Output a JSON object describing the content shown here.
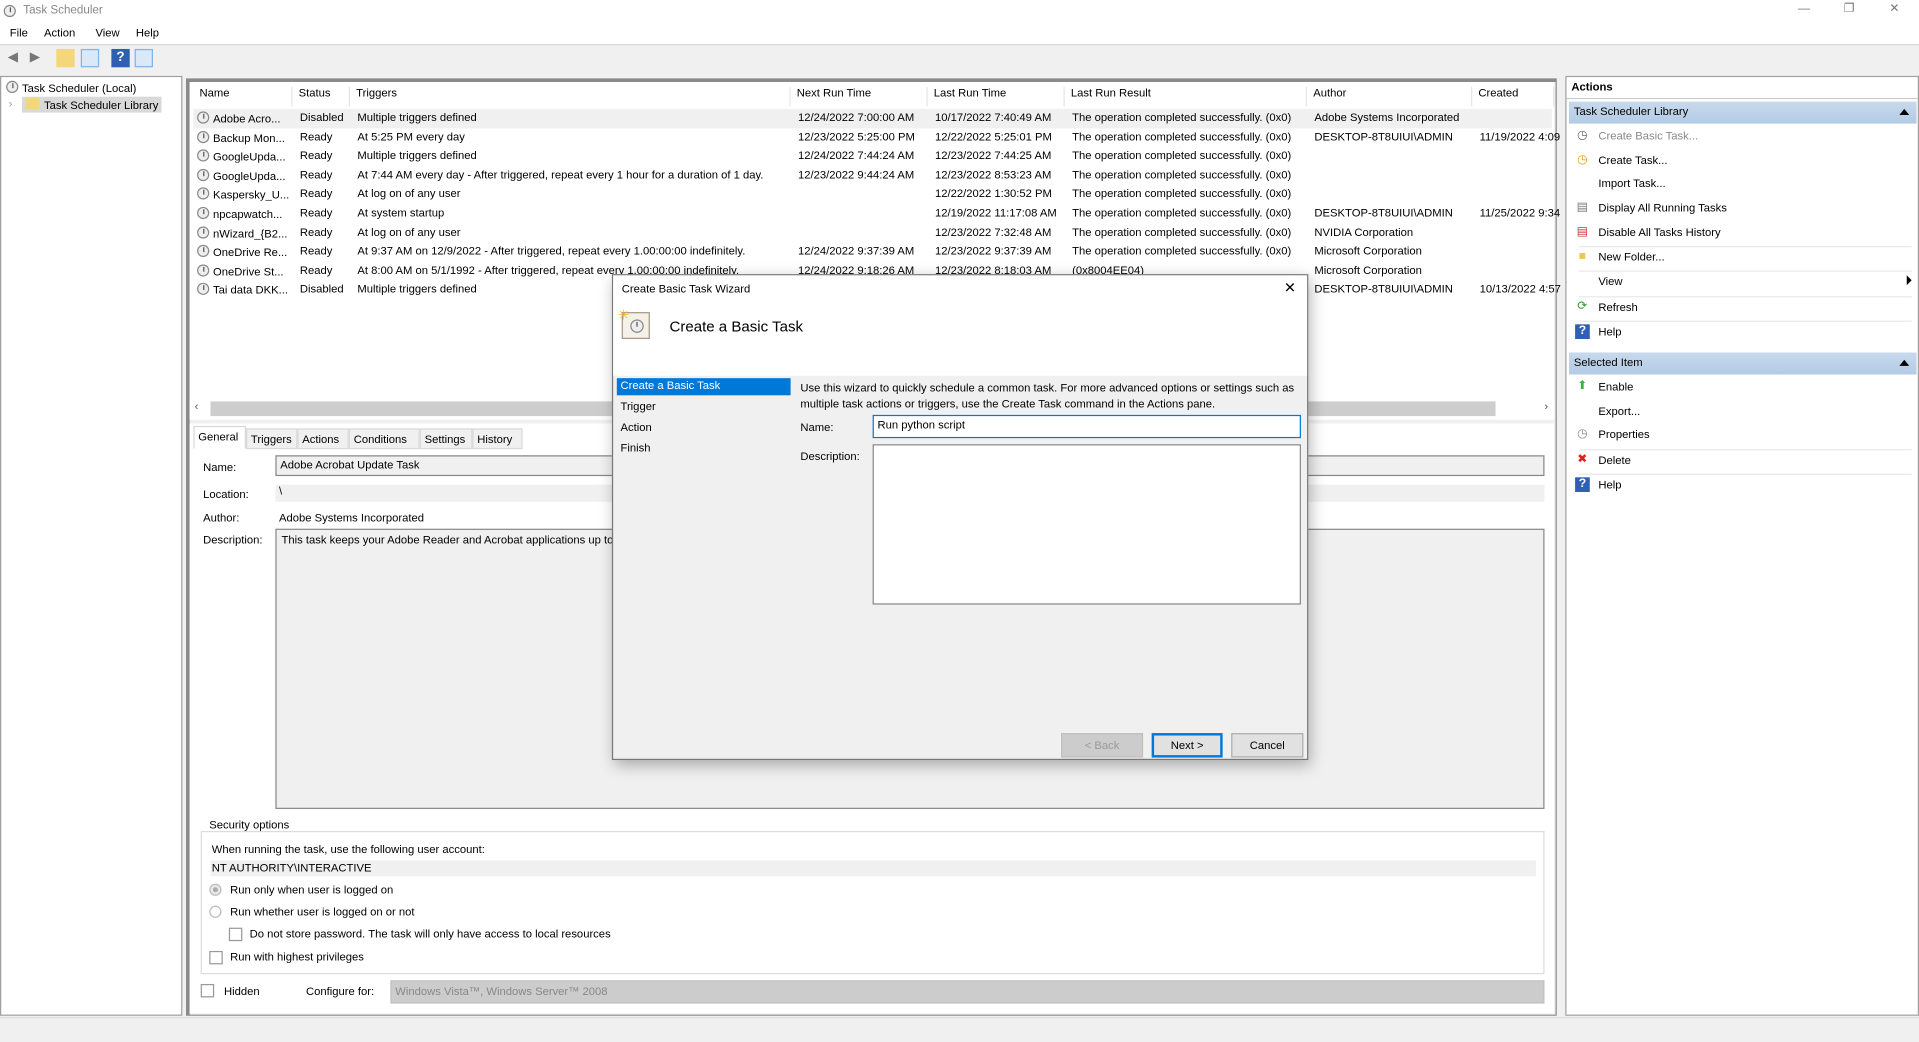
{
  "window": {
    "title": "Task Scheduler",
    "controls": [
      "minimize",
      "restore",
      "close"
    ]
  },
  "menu": [
    "File",
    "Action",
    "View",
    "Help"
  ],
  "toolbar": {
    "icons": [
      "back-icon",
      "forward-icon",
      "up-folder-icon",
      "show-hide-console-tree-icon",
      "help-icon",
      "show-hide-action-pane-icon"
    ]
  },
  "tree": {
    "root": "Task Scheduler (Local)",
    "child": "Task Scheduler Library"
  },
  "list": {
    "columns": [
      "Name",
      "Status",
      "Triggers",
      "Next Run Time",
      "Last Run Time",
      "Last Run Result",
      "Author",
      "Created"
    ],
    "rows": [
      [
        "Adobe Acro...",
        "Disabled",
        "Multiple triggers defined",
        "12/24/2022 7:00:00 AM",
        "10/17/2022 7:40:49 AM",
        "The operation completed successfully. (0x0)",
        "Adobe Systems Incorporated",
        ""
      ],
      [
        "Backup Mon...",
        "Ready",
        "At 5:25 PM every day",
        "12/23/2022 5:25:00 PM",
        "12/22/2022 5:25:01 PM",
        "The operation completed successfully. (0x0)",
        "DESKTOP-8T8UIUI\\ADMIN",
        "11/19/2022 4:09"
      ],
      [
        "GoogleUpda...",
        "Ready",
        "Multiple triggers defined",
        "12/24/2022 7:44:24 AM",
        "12/23/2022 7:44:25 AM",
        "The operation completed successfully. (0x0)",
        "",
        ""
      ],
      [
        "GoogleUpda...",
        "Ready",
        "At 7:44 AM every day - After triggered, repeat every 1 hour for a duration of 1 day.",
        "12/23/2022 9:44:24 AM",
        "12/23/2022 8:53:23 AM",
        "The operation completed successfully. (0x0)",
        "",
        ""
      ],
      [
        "Kaspersky_U...",
        "Ready",
        "At log on of any user",
        "",
        "12/22/2022 1:30:52 PM",
        "The operation completed successfully. (0x0)",
        "",
        ""
      ],
      [
        "npcapwatch...",
        "Ready",
        "At system startup",
        "",
        "12/19/2022 11:17:08 AM",
        "The operation completed successfully. (0x0)",
        "DESKTOP-8T8UIUI\\ADMIN",
        "11/25/2022 9:34"
      ],
      [
        "nWizard_{B2...",
        "Ready",
        "At log on of any user",
        "",
        "12/23/2022 7:32:48 AM",
        "The operation completed successfully. (0x0)",
        "NVIDIA Corporation",
        ""
      ],
      [
        "OneDrive Re...",
        "Ready",
        "At 9:37 AM on 12/9/2022 - After triggered, repeat every 1.00:00:00 indefinitely.",
        "12/24/2022 9:37:39 AM",
        "12/23/2022 9:37:39 AM",
        "The operation completed successfully. (0x0)",
        "Microsoft Corporation",
        ""
      ],
      [
        "OneDrive St...",
        "Ready",
        "At 8:00 AM on 5/1/1992 - After triggered, repeat every 1.00:00:00 indefinitely.",
        "12/24/2022 9:18:26 AM",
        "12/23/2022 8:18:03 AM",
        "(0x8004EE04)",
        "Microsoft Corporation",
        ""
      ],
      [
        "Tai data DKK...",
        "Disabled",
        "Multiple triggers defined",
        "",
        "",
        "",
        "DESKTOP-8T8UIUI\\ADMIN",
        "10/13/2022 4:57"
      ]
    ]
  },
  "detail": {
    "tabs": [
      "General",
      "Triggers",
      "Actions",
      "Conditions",
      "Settings",
      "History"
    ],
    "name_label": "Name:",
    "name_value": "Adobe Acrobat Update Task",
    "location_label": "Location:",
    "location_value": "\\",
    "author_label": "Author:",
    "author_value": "Adobe Systems Incorporated",
    "description_label": "Description:",
    "description_value": "This task keeps your Adobe Reader and Acrobat applications up to date with the latest enhancements and security fixes",
    "security": {
      "legend": "Security options",
      "account_label": "When running the task, use the following user account:",
      "account_value": "NT AUTHORITY\\INTERACTIVE",
      "radio1": "Run only when user is logged on",
      "radio2": "Run whether user is logged on or not",
      "no_store": "Do not store password.  The task will only have access to local resources",
      "highest": "Run with highest privileges"
    },
    "hidden_label": "Hidden",
    "configure_label": "Configure for:",
    "configure_value": "Windows Vista™, Windows Server™ 2008"
  },
  "actions": {
    "title": "Actions",
    "section1": "Task Scheduler Library",
    "items1": [
      {
        "label": "Create Basic Task...",
        "icon": "create-basic-task-icon",
        "disabled": true
      },
      {
        "label": "Create Task...",
        "icon": "create-task-icon"
      },
      {
        "label": "Import Task...",
        "icon": ""
      },
      {
        "label": "Display All Running Tasks",
        "icon": "running-tasks-icon"
      },
      {
        "label": "Disable All Tasks History",
        "icon": "history-icon"
      },
      {
        "label": "New Folder...",
        "icon": "new-folder-icon"
      },
      {
        "label": "View",
        "icon": "",
        "submenu": true
      },
      {
        "label": "Refresh",
        "icon": "refresh-icon"
      },
      {
        "label": "Help",
        "icon": "help-icon"
      }
    ],
    "section2": "Selected Item",
    "items2": [
      {
        "label": "Enable",
        "icon": "enable-arrow-icon"
      },
      {
        "label": "Export...",
        "icon": ""
      },
      {
        "label": "Properties",
        "icon": "properties-icon"
      },
      {
        "label": "Delete",
        "icon": "delete-x-icon"
      },
      {
        "label": "Help",
        "icon": "help-icon"
      }
    ]
  },
  "wizard": {
    "title": "Create Basic Task Wizard",
    "heading": "Create a Basic Task",
    "steps": [
      "Create a Basic Task",
      "Trigger",
      "Action",
      "Finish"
    ],
    "intro": "Use this wizard to quickly schedule a common task.  For more advanced options or settings such as multiple task actions or triggers, use the Create Task command in the Actions pane.",
    "name_label": "Name:",
    "name_value": "Run python script",
    "description_label": "Description:",
    "description_value": "",
    "back": "< Back",
    "next": "Next >",
    "cancel": "Cancel"
  },
  "colors": {
    "selection": "#0078d7",
    "section_header": "#bcd1ea"
  }
}
